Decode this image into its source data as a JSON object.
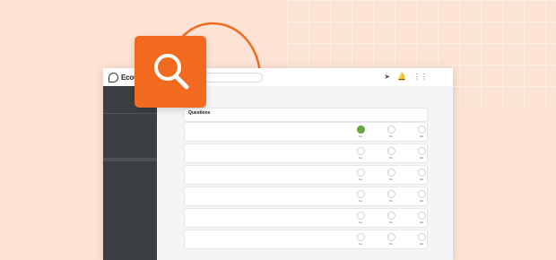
{
  "app": {
    "logo_text": "EcoO"
  },
  "sidebar": {
    "user_lines": [
      "",
      "",
      ""
    ],
    "items": [
      {
        "label": ""
      },
      {
        "label": ""
      },
      {
        "label": ""
      },
      {
        "label": ""
      },
      {
        "label": ""
      },
      {
        "label": ""
      },
      {
        "label": ""
      },
      {
        "label": ""
      },
      {
        "label": ""
      },
      {
        "label": ""
      },
      {
        "label": ""
      },
      {
        "label": ""
      },
      {
        "label": ""
      },
      {
        "label": ""
      },
      {
        "label": ""
      }
    ]
  },
  "questions": {
    "title": "Questions",
    "subtitle": "",
    "options": [
      "Yes",
      "No",
      "N/A"
    ],
    "items": [
      {
        "text": "",
        "selected": 0
      },
      {
        "text": "",
        "selected": -1
      },
      {
        "text": "",
        "selected": -1
      },
      {
        "text": "",
        "selected": -1
      },
      {
        "text": "",
        "selected": -1
      },
      {
        "text": "",
        "selected": -1
      }
    ]
  },
  "colors": {
    "accent": "#f26a1f",
    "sidebar": "#3b3f44",
    "selected": "#6aab3f"
  },
  "icons": [
    "search-icon",
    "send-icon",
    "bell-icon",
    "grid-icon"
  ]
}
